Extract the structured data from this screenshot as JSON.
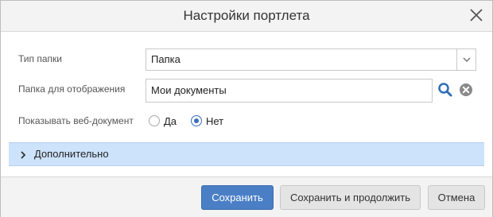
{
  "dialog": {
    "title": "Настройки портлета",
    "close_icon": "close-icon"
  },
  "form": {
    "folder_type": {
      "label": "Тип папки",
      "value": "Папка",
      "icon": "chevron-down-icon"
    },
    "display_folder": {
      "label": "Папка для отображения",
      "value": "Мои документы",
      "search_icon": "search-icon",
      "clear_icon": "clear-icon"
    },
    "show_web_document": {
      "label": "Показывать веб-документ",
      "options": [
        "Да",
        "Нет"
      ],
      "selected": "Нет"
    }
  },
  "advanced": {
    "label": "Дополнительно",
    "icon": "chevron-right-icon"
  },
  "footer": {
    "save": "Сохранить",
    "save_continue": "Сохранить и продолжить",
    "cancel": "Отмена"
  },
  "colors": {
    "primary": "#4a7fc6",
    "section_bg": "#cde2fb",
    "search_icon": "#2f6db8",
    "clear_icon": "#8a8a8a"
  }
}
